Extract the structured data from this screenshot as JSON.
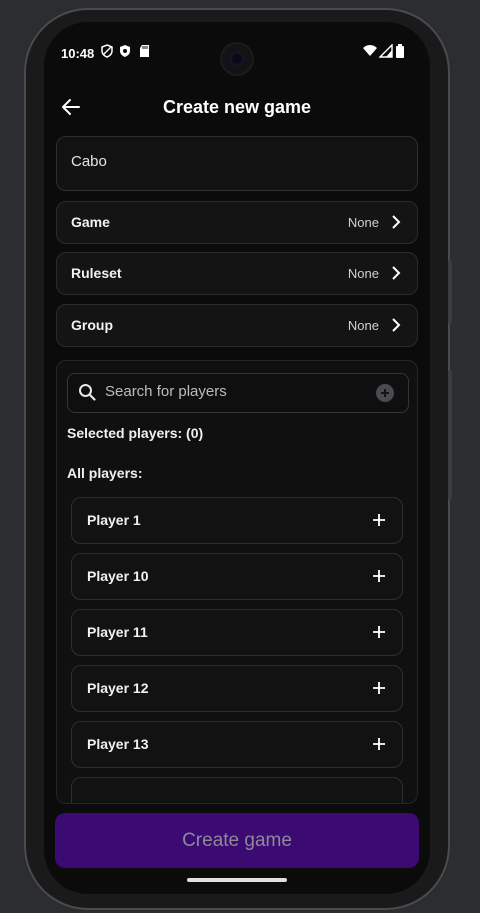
{
  "status_bar": {
    "time": "10:48",
    "left_icons": [
      "shield-outline-icon",
      "shield-icon",
      "sd-card-icon"
    ],
    "right_icons": [
      "wifi-icon",
      "signal-icon",
      "battery-icon"
    ]
  },
  "app_bar": {
    "title": "Create new game",
    "back_icon": "arrow-left-icon"
  },
  "form": {
    "name_value": "Cabo",
    "rows": [
      {
        "label": "Game",
        "value": "None"
      },
      {
        "label": "Ruleset",
        "value": "None"
      },
      {
        "label": "Group",
        "value": "None"
      }
    ]
  },
  "players": {
    "search_placeholder": "Search for players",
    "selected_label": "Selected players: (0)",
    "all_label": "All players:",
    "list": [
      "Player 1",
      "Player 10",
      "Player 11",
      "Player 12",
      "Player 13"
    ]
  },
  "actions": {
    "create_label": "Create game"
  },
  "colors": {
    "background": "#0b0b0c",
    "primary_disabled": "#3b0a73",
    "text": "#f1f1f1"
  }
}
